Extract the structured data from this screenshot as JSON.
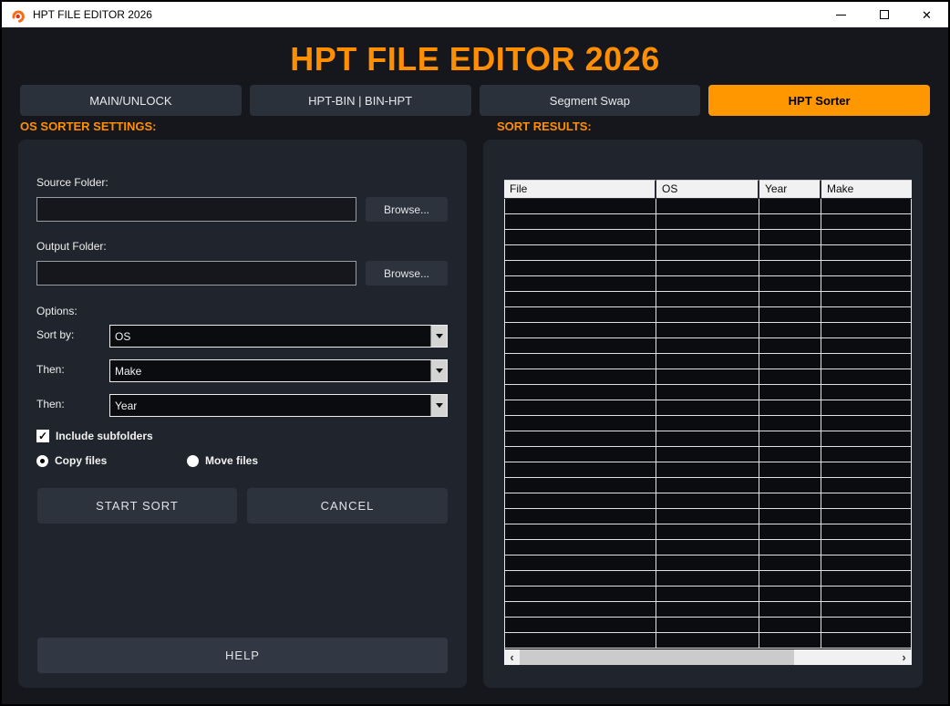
{
  "window": {
    "title": "HPT FILE EDITOR 2026"
  },
  "header": {
    "app_title": "HPT FILE EDITOR 2026"
  },
  "tabs": [
    {
      "label": "MAIN/UNLOCK",
      "active": false
    },
    {
      "label": "HPT-BIN | BIN-HPT",
      "active": false
    },
    {
      "label": "Segment Swap",
      "active": false
    },
    {
      "label": "HPT Sorter",
      "active": true
    }
  ],
  "sorter": {
    "section_title": "OS SORTER SETTINGS:",
    "source_folder_label": "Source Folder:",
    "source_folder_value": "",
    "output_folder_label": "Output Folder:",
    "output_folder_value": "",
    "browse_label": "Browse...",
    "options_label": "Options:",
    "sort_by_label": "Sort by:",
    "sort_by_value": "OS",
    "then1_label": "Then:",
    "then1_value": "Make",
    "then2_label": "Then:",
    "then2_value": "Year",
    "include_subfolders_label": "Include subfolders",
    "include_subfolders_checked": true,
    "copy_files_label": "Copy files",
    "move_files_label": "Move files",
    "selected_mode": "copy",
    "start_button": "START SORT",
    "cancel_button": "CANCEL",
    "help_button": "HELP"
  },
  "results": {
    "section_title": "SORT RESULTS:",
    "columns": [
      "File",
      "OS",
      "Year",
      "Make"
    ],
    "rows": [],
    "empty_row_count": 29
  },
  "icons": {
    "close": "✕",
    "check": "✓",
    "scroll_left": "‹",
    "scroll_right": "›"
  },
  "colors": {
    "accent_orange": "#FF8F00",
    "tab_active_bg": "#FF9800",
    "titlebar_bg": "#FFFFFF",
    "window_bg": "#15171C",
    "panel_bg": "#20242C"
  }
}
